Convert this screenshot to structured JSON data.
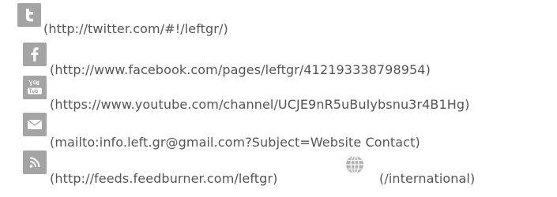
{
  "links": {
    "twitter": {
      "icon": "twitter-icon",
      "text": "(http://twitter.com/#!/leftgr/)"
    },
    "facebook": {
      "icon": "facebook-icon",
      "text": "(http://www.facebook.com/pages/leftgr/412193338798954)"
    },
    "youtube": {
      "icon": "youtube-icon",
      "text": "(https://www.youtube.com/channel/UCJE9nR5uBuIybsnu3r4B1Hg)"
    },
    "email": {
      "icon": "mail-icon",
      "text": "(mailto:info.left.gr@gmail.com?Subject=Website Contact)"
    },
    "rss": {
      "icon": "rss-icon",
      "text": "(http://feeds.feedburner.com/leftgr)"
    },
    "international": {
      "icon": "globe-icon",
      "text": "(/international)"
    }
  },
  "colors": {
    "icon_background": "#a4a4a4",
    "icon_glyph": "#ffffff",
    "text": "#555555",
    "globe": "#a8a8a8"
  }
}
